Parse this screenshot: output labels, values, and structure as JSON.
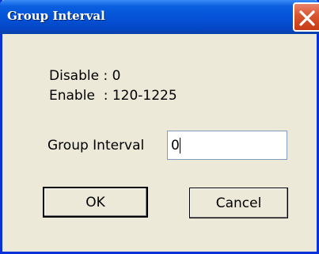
{
  "window": {
    "title": "Group Interval",
    "close_icon": "close-icon"
  },
  "info": {
    "disable_text": "Disable : 0",
    "enable_text": "Enable  : 120-1225"
  },
  "field": {
    "label": "Group Interval",
    "value": "0"
  },
  "buttons": {
    "ok_label": "OK",
    "cancel_label": "Cancel"
  },
  "colors": {
    "titlebar": "#0553d8",
    "window_bg": "#ece9d8",
    "close_button": "#d9542e"
  }
}
